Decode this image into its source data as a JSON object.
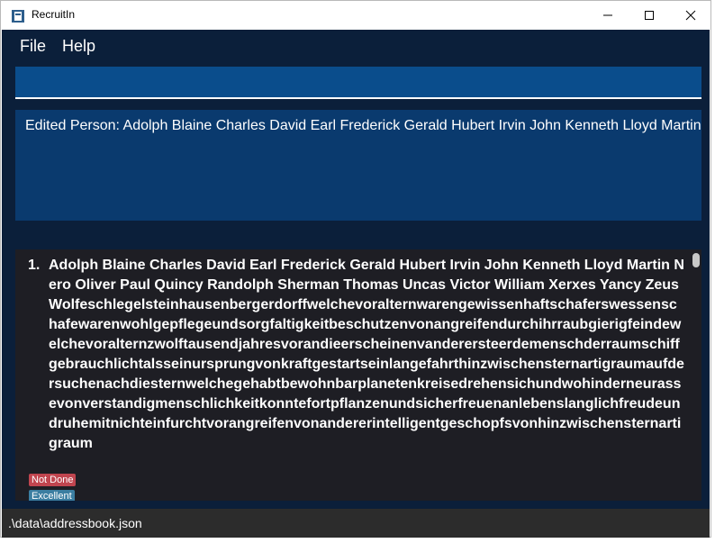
{
  "window": {
    "title": "RecruitIn"
  },
  "menu": {
    "file": "File",
    "help": "Help"
  },
  "command": {
    "value": ""
  },
  "result": {
    "message": "Edited Person: Adolph Blaine Charles David Earl Frederick Gerald Hubert Irvin John Kenneth Lloyd Martin Nero Oliver Paul Quincy Randolph Sherman Thomas Uncas Victor William Xerxes Yancy Zeus Wolfeschlegelsteinhausenbergerdorffwelchevoralternwarengewissenhaftschaferswessenschafewarenwohlgepflegeundsorgfaltigkeitbeschutzenvonangreifendurchihrraubgierigfeinde"
  },
  "persons": [
    {
      "index": "1.",
      "name": "Adolph Blaine Charles David Earl Frederick Gerald Hubert Irvin John Kenneth Lloyd Martin Nero Oliver Paul Quincy Randolph Sherman Thomas Uncas Victor William Xerxes Yancy Zeus Wolfeschlegelsteinhausenbergerdorffwelchevoralternwarengewissenhaftschaferswessenschafewarenwohlgepflegeundsorgfaltigkeitbeschutzenvonangreifendurchihrraubgierigfeindewelchevoralternzwolftausendjahresvorandieerscheinenvanderersteerdemenschderraumschiffgebrauchlichtalsseinursprungvonkraftgestartseinlangefahrthinzwischensternartigraumaufdersuchenachdiesternwelchegehabtbewohnbarplanetenkreisedrehensichundwohinderneurassevonverstandigmenschlichkeitkonntefortpflanzenundsicherfreuenanlebenslanglichfreudeundruhemitnichteinfurchtvorangreifenvonandererintelligentgeschopfsvonhinzwischensternartigraum",
      "tags": [
        "Not Done",
        "Excellent"
      ]
    }
  ],
  "status": {
    "path": ".\\data\\addressbook.json"
  },
  "colors": {
    "background": "#0b1f3a",
    "tag_not_done": "#c0454f",
    "tag_excellent": "#3b7ea1"
  },
  "icons": [
    "app-icon",
    "minimize-icon",
    "maximize-icon",
    "close-icon"
  ]
}
